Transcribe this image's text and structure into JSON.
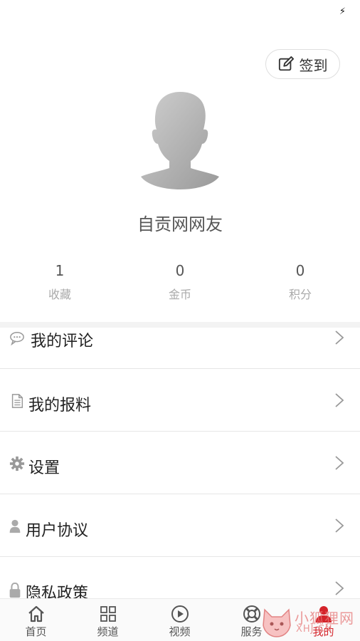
{
  "status_bar": {
    "charging_icon": "bolt-icon"
  },
  "checkin": {
    "label": "签到",
    "icon": "edit-square-icon"
  },
  "profile": {
    "avatar_icon": "default-avatar-silhouette",
    "username": "自贡网网友"
  },
  "stats": [
    {
      "value": "1",
      "label": "收藏"
    },
    {
      "value": "0",
      "label": "金币"
    },
    {
      "value": "0",
      "label": "积分"
    }
  ],
  "menu": [
    {
      "label": "我的评论",
      "icon": "comment-bubble-icon"
    },
    {
      "label": "我的报料",
      "icon": "document-icon"
    },
    {
      "label": "设置",
      "icon": "gear-icon"
    },
    {
      "label": "用户协议",
      "icon": "user-icon"
    },
    {
      "label": "隐私政策",
      "icon": "lock-icon"
    }
  ],
  "tabbar": [
    {
      "label": "首页",
      "icon": "home-icon"
    },
    {
      "label": "频道",
      "icon": "grid-icon"
    },
    {
      "label": "视频",
      "icon": "play-circle-icon"
    },
    {
      "label": "服务",
      "icon": "lifebuoy-icon"
    },
    {
      "label": "我的",
      "icon": "person-icon",
      "active": true
    }
  ],
  "watermark": {
    "line1": "小狐狸网",
    "line2": "XHJ.CN",
    "icon": "fox-logo-icon"
  },
  "colors": {
    "accent": "#d4232a",
    "divider": "#e6e6e6",
    "muted": "#aaaaaa"
  }
}
